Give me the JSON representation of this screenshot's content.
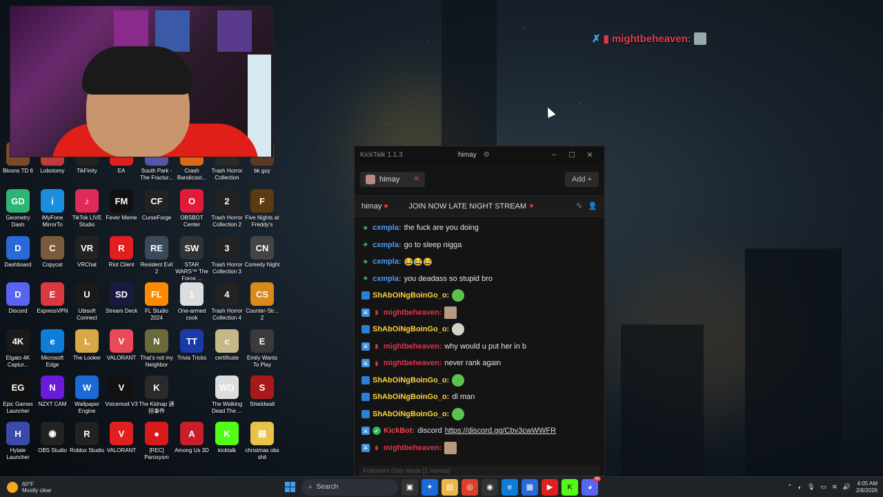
{
  "overlay": {
    "username": "mightbeheaven:"
  },
  "desktop_icons": [
    {
      "label": "Bloons TD 6",
      "color": "#7b4a2a",
      "glyph": "B"
    },
    {
      "label": "Lobotomy",
      "color": "#c23b3b",
      "glyph": "L"
    },
    {
      "label": "TikFinity",
      "color": "#222",
      "glyph": "T"
    },
    {
      "label": "EA",
      "color": "#e02020",
      "glyph": "EA"
    },
    {
      "label": "South Park - The Fractur...",
      "color": "#55a",
      "glyph": "SP"
    },
    {
      "label": "Crash Bandicoot...",
      "color": "#d86a1a",
      "glyph": "C"
    },
    {
      "label": "Trash Horror Collection",
      "color": "#2a2a2a",
      "glyph": "T"
    },
    {
      "label": "bk guy",
      "color": "#5a3a20",
      "glyph": "bk"
    },
    {
      "label": "Geometry Dash",
      "color": "#2bb673",
      "glyph": "GD"
    },
    {
      "label": "iMyFone MirrorTo",
      "color": "#1a8fe0",
      "glyph": "i"
    },
    {
      "label": "TikTok LIVE Studio",
      "color": "#e02a5a",
      "glyph": "♪"
    },
    {
      "label": "Fever Meme",
      "color": "#111",
      "glyph": "FM"
    },
    {
      "label": "CurseForge",
      "color": "#222",
      "glyph": "CF"
    },
    {
      "label": "OBSBOT Center",
      "color": "#e21a3a",
      "glyph": "O"
    },
    {
      "label": "Trash Horror Collection 2",
      "color": "#222",
      "glyph": "2"
    },
    {
      "label": "Five Nights at Freddy's",
      "color": "#5a3a10",
      "glyph": "F"
    },
    {
      "label": "Dashboard",
      "color": "#2a6ad8",
      "glyph": "D"
    },
    {
      "label": "Copycat",
      "color": "#7a5a3a",
      "glyph": "C"
    },
    {
      "label": "VRChat",
      "color": "#222",
      "glyph": "VR"
    },
    {
      "label": "Riot Client",
      "color": "#e02020",
      "glyph": "R"
    },
    {
      "label": "Resident Evil 2",
      "color": "#3a4a5a",
      "glyph": "RE"
    },
    {
      "label": "STAR WARS™ The Force ...",
      "color": "#333",
      "glyph": "SW"
    },
    {
      "label": "Trash Horror Collection 3",
      "color": "#222",
      "glyph": "3"
    },
    {
      "label": "Comedy Night",
      "color": "#444",
      "glyph": "CN"
    },
    {
      "label": "Discord",
      "color": "#5865f2",
      "glyph": "D"
    },
    {
      "label": "ExpressVPN",
      "color": "#da3940",
      "glyph": "E"
    },
    {
      "label": "Ubisoft Connect",
      "color": "#1a1a1a",
      "glyph": "U"
    },
    {
      "label": "Stream Deck",
      "color": "#1a1a40",
      "glyph": "SD"
    },
    {
      "label": "FL Studio 2024",
      "color": "#ff8a00",
      "glyph": "FL"
    },
    {
      "label": "One-armed cook",
      "color": "#ddd",
      "glyph": "1"
    },
    {
      "label": "Trash Horror Collection 4",
      "color": "#222",
      "glyph": "4"
    },
    {
      "label": "Counter-Str... 2",
      "color": "#d88a1a",
      "glyph": "CS"
    },
    {
      "label": "Elgato 4K Captur...",
      "color": "#1a1a1a",
      "glyph": "4K"
    },
    {
      "label": "Microsoft Edge",
      "color": "#0f7dd8",
      "glyph": "e"
    },
    {
      "label": "The Looker",
      "color": "#d8a848",
      "glyph": "L"
    },
    {
      "label": "VALORANT",
      "color": "#e84a5a",
      "glyph": "V"
    },
    {
      "label": "That's not my Neighbor",
      "color": "#6a6a3a",
      "glyph": "N"
    },
    {
      "label": "Trivia Tricks",
      "color": "#1a3aa8",
      "glyph": "TT"
    },
    {
      "label": "certificate",
      "color": "#c8b888",
      "glyph": "c"
    },
    {
      "label": "Emily Wants To Play",
      "color": "#3a3a3a",
      "glyph": "E"
    },
    {
      "label": "Epic Games Launcher",
      "color": "#111",
      "glyph": "EG"
    },
    {
      "label": "NZXT CAM",
      "color": "#6a1ad8",
      "glyph": "N"
    },
    {
      "label": "Wallpaper Engine",
      "color": "#1a6ad8",
      "glyph": "W"
    },
    {
      "label": "Voicemod V3",
      "color": "#111",
      "glyph": "V"
    },
    {
      "label": "The Kidnap 誘拐事件",
      "color": "#2a2a2a",
      "glyph": "K"
    },
    {
      "label": "",
      "color": "transparent",
      "glyph": ""
    },
    {
      "label": "The Walking Dead The ...",
      "color": "#ddd",
      "glyph": "WD"
    },
    {
      "label": "Shieldwall",
      "color": "#a81a1a",
      "glyph": "S"
    },
    {
      "label": "Hytale Launcher",
      "color": "#3a4aa8",
      "glyph": "H"
    },
    {
      "label": "OBS Studio",
      "color": "#222",
      "glyph": "◉"
    },
    {
      "label": "Roblox Studio",
      "color": "#222",
      "glyph": "R"
    },
    {
      "label": "VALORANT",
      "color": "#e02020",
      "glyph": "V"
    },
    {
      "label": "[REC] Paroxysm",
      "color": "#d81a1a",
      "glyph": "●"
    },
    {
      "label": "Among Us 3D",
      "color": "#c8202a",
      "glyph": "A"
    },
    {
      "label": "kicktalk",
      "color": "#53fc18",
      "glyph": "K"
    },
    {
      "label": "christmas obs shit",
      "color": "#e8c24a",
      "glyph": "▤"
    }
  ],
  "kicktalk": {
    "app_title": "KickTalk 1.1.3",
    "titlebar_user": "himay",
    "tab_label": "himay",
    "add_label": "Add",
    "channel_name": "himay",
    "stream_title": "JOIN NOW LATE NIGHT STREAM",
    "footer": "Followers Only Mode [1 minute]",
    "messages": [
      {
        "badges": [
          "ax"
        ],
        "user": "cxmpla:",
        "ucolor": "u-blue",
        "text": "the fuck are you doing"
      },
      {
        "badges": [
          "ax"
        ],
        "user": "cxmpla:",
        "ucolor": "u-blue",
        "text": "go to sleep nigga"
      },
      {
        "badges": [
          "ax"
        ],
        "user": "cxmpla:",
        "ucolor": "u-blue",
        "text": "😂😂😂"
      },
      {
        "badges": [
          "ax"
        ],
        "user": "cxmpla:",
        "ucolor": "u-blue",
        "text": "you deadass so stupid bro"
      },
      {
        "badges": [
          "cube"
        ],
        "user": "ShAbOiNgBoinGo_o:",
        "ucolor": "u-yellow",
        "text": "",
        "emote": "green"
      },
      {
        "badges": [
          "mod",
          "red"
        ],
        "user": "mightbeheaven:",
        "ucolor": "u-red",
        "text": "",
        "emote": "photo"
      },
      {
        "badges": [
          "cube"
        ],
        "user": "ShAbOiNgBoinGo_o:",
        "ucolor": "u-yellow",
        "text": "",
        "emote": "alien"
      },
      {
        "badges": [
          "mod",
          "red"
        ],
        "user": "mightbeheaven:",
        "ucolor": "u-red",
        "text": "why would u put her in b"
      },
      {
        "badges": [
          "mod",
          "red"
        ],
        "user": "mightbeheaven:",
        "ucolor": "u-red",
        "text": "never rank again"
      },
      {
        "badges": [
          "cube"
        ],
        "user": "ShAbOiNgBoinGo_o:",
        "ucolor": "u-yellow",
        "text": "",
        "emote": "green"
      },
      {
        "badges": [
          "cube"
        ],
        "user": "ShAbOiNgBoinGo_o:",
        "ucolor": "u-yellow",
        "text": "dl man"
      },
      {
        "badges": [
          "cube"
        ],
        "user": "ShAbOiNgBoinGo_o:",
        "ucolor": "u-yellow",
        "text": "",
        "emote": "green"
      },
      {
        "badges": [
          "mod",
          "check"
        ],
        "user": "KickBot:",
        "ucolor": "u-green",
        "text": "discord",
        "link": "https://discord.gg/Cbv3cwWWFR"
      },
      {
        "badges": [
          "mod",
          "red"
        ],
        "user": "mightbeheaven:",
        "ucolor": "u-red",
        "text": "",
        "emote": "photo"
      }
    ]
  },
  "taskbar": {
    "temp": "60°F",
    "condition": "Mostly clear",
    "search_label": "Search",
    "time": "4:05 AM",
    "date": "2/8/2026",
    "discord_badge": "99"
  }
}
